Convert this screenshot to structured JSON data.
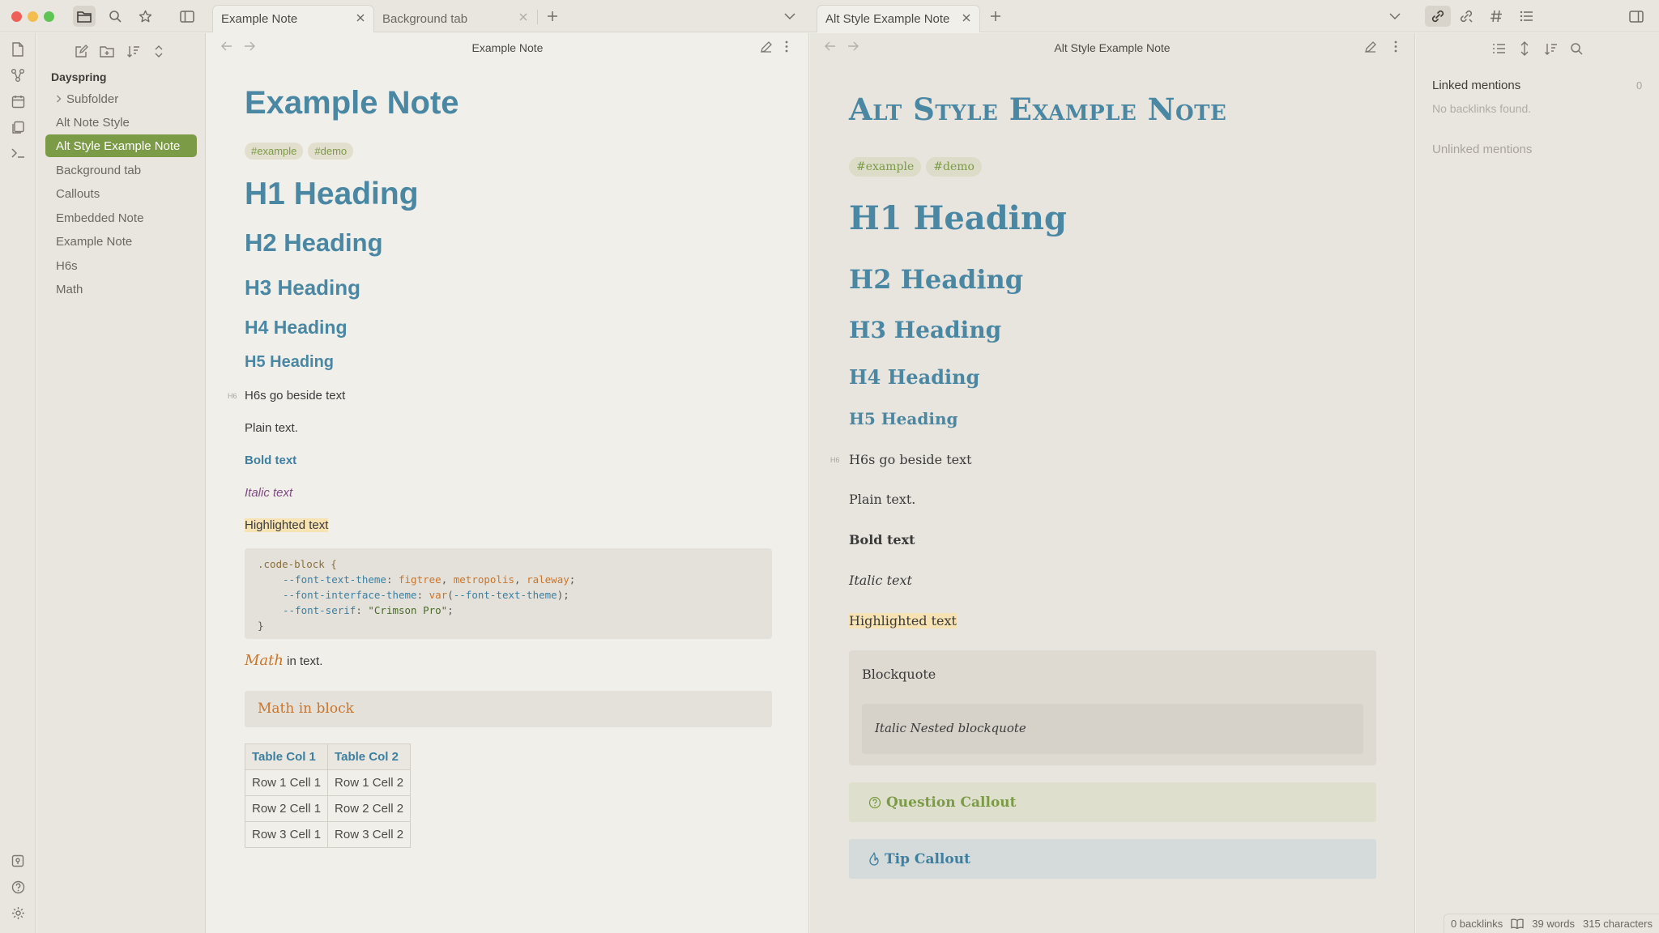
{
  "window": {
    "tabs_left": [
      {
        "label": "Example Note",
        "active": true
      },
      {
        "label": "Background tab",
        "active": false
      }
    ],
    "tabs_right": [
      {
        "label": "Alt Style Example Note",
        "active": true
      }
    ],
    "new_tab_symbol": "+"
  },
  "ribbon": {
    "icons": [
      "new-note-icon",
      "graph-view-icon",
      "daily-notes-icon",
      "templates-icon",
      "command-palette-icon",
      "vault-switcher-icon",
      "help-icon",
      "settings-icon"
    ]
  },
  "explorer": {
    "vault_name": "Dayspring",
    "items": [
      {
        "label": "Subfolder",
        "type": "folder"
      },
      {
        "label": "Alt Note Style",
        "type": "file"
      },
      {
        "label": "Alt Style Example Note",
        "type": "file",
        "active": true
      },
      {
        "label": "Background tab",
        "type": "file"
      },
      {
        "label": "Callouts",
        "type": "file"
      },
      {
        "label": "Embedded Note",
        "type": "file"
      },
      {
        "label": "Example Note",
        "type": "file"
      },
      {
        "label": "H6s",
        "type": "file"
      },
      {
        "label": "Math",
        "type": "file"
      }
    ]
  },
  "left_pane": {
    "header_title": "Example Note",
    "note_title": "Example Note",
    "tags": [
      "#example",
      "#demo"
    ],
    "h1": "H1 Heading",
    "h2": "H2 Heading",
    "h3": "H3 Heading",
    "h4": "H4 Heading",
    "h5": "H5 Heading",
    "h6_gutter": "H6",
    "h6": "H6s go beside text",
    "plain": "Plain text.",
    "bold": "Bold text",
    "italic": "Italic text",
    "highlight": "Highlighted text",
    "code_lines": [
      {
        "selector": ".code-block {"
      },
      {
        "prop": "--font-text-theme",
        "values": [
          "figtree",
          "metropolis",
          "raleway"
        ]
      },
      {
        "prop": "--font-interface-theme",
        "func": "var",
        "arg": "--font-text-theme"
      },
      {
        "prop": "--font-serif",
        "string": "\"Crimson Pro\""
      },
      {
        "selector": "}"
      }
    ],
    "math_inline": "Math",
    "math_inline_suffix": "in text.",
    "math_block": "Math in block",
    "table": {
      "headers": [
        "Table Col 1",
        "Table Col 2"
      ],
      "rows": [
        [
          "Row 1 Cell 1",
          "Row 1 Cell 2"
        ],
        [
          "Row 2 Cell 1",
          "Row 2 Cell 2"
        ],
        [
          "Row 3 Cell 1",
          "Row 3 Cell 2"
        ]
      ]
    }
  },
  "right_pane": {
    "header_title": "Alt Style Example Note",
    "note_title": "Alt Style Example Note",
    "tags": [
      "#example",
      "#demo"
    ],
    "h1": "H1 Heading",
    "h2": "H2 Heading",
    "h3": "H3 Heading",
    "h4": "H4 Heading",
    "h5": "H5 Heading",
    "h6_gutter": "H6",
    "h6": "H6s go beside text",
    "plain": "Plain text.",
    "bold": "Bold text",
    "italic": "Italic text",
    "highlight": "Highlighted text",
    "blockquote": "Blockquote",
    "nested_blockquote": "Italic Nested blockquote",
    "callouts": [
      {
        "label": "Question Callout",
        "icon": "question-circle-icon",
        "color": "#7c9b46",
        "bg": "#dee0cd"
      },
      {
        "label": "Tip Callout",
        "icon": "flame-icon",
        "color": "#3d7fa0",
        "bg": "#d5dadb"
      }
    ]
  },
  "right_sidebar": {
    "linked_mentions": "Linked mentions",
    "linked_count": "0",
    "no_backlinks": "No backlinks found.",
    "unlinked_mentions": "Unlinked mentions"
  },
  "status_bar": {
    "backlinks": "0 backlinks",
    "words": "39 words",
    "characters": "315 characters"
  },
  "colors": {
    "accent": "#7c9b46",
    "heading": "#4a87a3",
    "math": "#c9752c",
    "italic": "#7d4a82",
    "highlight": "#f7e2b3"
  }
}
